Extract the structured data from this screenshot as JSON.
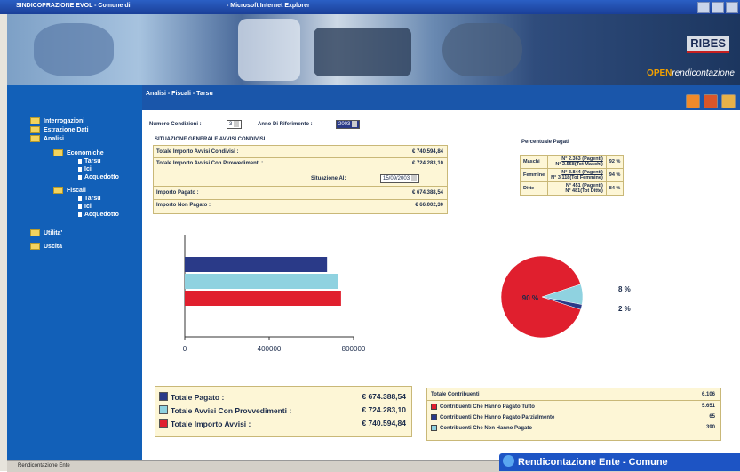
{
  "window": {
    "title": "SINDICOPRAZIONE EVOL - Comune di",
    "browser": "- Microsoft Internet Explorer"
  },
  "banner": {
    "brand": "RIBES",
    "product_a": "OPEN",
    "product_b": "rendicontazione"
  },
  "navbar": {
    "breadcrumb": "Analisi - Fiscali - Tarsu"
  },
  "sidebar": {
    "items": [
      {
        "label": "Interrogazioni"
      },
      {
        "label": "Estrazione Dati"
      },
      {
        "label": "Analisi"
      },
      {
        "label": "Economiche"
      },
      {
        "label": "Tarsu"
      },
      {
        "label": "Ici"
      },
      {
        "label": "Acquedotto"
      },
      {
        "label": "Fiscali"
      },
      {
        "label": "Tarsu"
      },
      {
        "label": "Ici"
      },
      {
        "label": "Acquedotto"
      },
      {
        "label": "Utilita'"
      },
      {
        "label": "Uscita"
      }
    ]
  },
  "filters": {
    "num_label": "Numero Condizioni :",
    "num_value": "3",
    "anno_label": "Anno Di Riferimento :",
    "anno_value": "2003"
  },
  "summary": {
    "heading": "SITUAZIONE GENERALE AVVISI CONDIVISI",
    "rows": [
      {
        "label": "Totale Importo Avvisi Condivisi :",
        "value": "€ 740.594,84"
      },
      {
        "label": "Totale Importo Avvisi Con Provvedimenti :",
        "value": "€ 724.283,10"
      },
      {
        "label": "Importo Pagato :",
        "value": "€ 674.388,54"
      },
      {
        "label": "Importo Non Pagato :",
        "value": "€ 66.002,30"
      }
    ],
    "situation_label": "Situazione Al:",
    "situation_date": "15/09/2003"
  },
  "percent_table": {
    "heading": "Percentuale Pagati",
    "rows": [
      {
        "group": "Maschi",
        "line1": "N° 2.363 (Pagenti)",
        "line2": "N° 2.558(Tot Maschi)",
        "pct": "92 %"
      },
      {
        "group": "Femmine",
        "line1": "N° 3.844 (Pagenti)",
        "line2": "N° 3.118(Tot Femmine)",
        "pct": "94 %"
      },
      {
        "group": "Ditte",
        "line1": "N° 451 (Pagenti)",
        "line2": "N° 481(Tot Ditte)",
        "pct": "84 %"
      }
    ]
  },
  "chart_data": [
    {
      "type": "bar",
      "orientation": "horizontal",
      "categories": [
        "Totale Pagato",
        "Totale Avvisi Con Provvedimenti",
        "Totale Importo Avvisi"
      ],
      "values": [
        674388.54,
        724283.1,
        740594.84
      ],
      "colors": [
        "#2a3a88",
        "#8fd2e0",
        "#e01f2e"
      ],
      "xlim": [
        0,
        800000
      ],
      "xticks": [
        "0",
        "400000",
        "800000"
      ]
    },
    {
      "type": "pie",
      "labels": [
        "Contribuenti Che Hanno Pagato Tutto",
        "Contribuenti Che Non Hanno Pagato",
        "Contribuenti Che Hanno Pagato Parzialmente"
      ],
      "values": [
        90,
        8,
        2
      ],
      "data_labels": [
        "90 %",
        "8 %",
        "2 %"
      ],
      "colors": [
        "#e01f2e",
        "#8fd2e0",
        "#2a3a88"
      ]
    }
  ],
  "legend": {
    "items": [
      {
        "label": "Totale Pagato :",
        "value": "€ 674.388,54",
        "color": "#2a3a88"
      },
      {
        "label": "Totale Avvisi Con Provvedimenti :",
        "value": "€ 724.283,10",
        "color": "#8fd2e0"
      },
      {
        "label": "Totale Importo Avvisi :",
        "value": "€ 740.594,84",
        "color": "#e01f2e"
      }
    ]
  },
  "contrib": {
    "heading": "Totale Contribuenti",
    "heading_value": "6.106",
    "rows": [
      {
        "label": "Contribuenti Che Hanno Pagato Tutto",
        "value": "5.651",
        "color": "#e01f2e"
      },
      {
        "label": "Contribuenti Che Hanno Pagato Parzialmente",
        "value": "65",
        "color": "#2a3a88"
      },
      {
        "label": "Contribuenti Che Non Hanno Pagato",
        "value": "390",
        "color": "#8fd2e0"
      }
    ]
  },
  "statusbar": {
    "text": "Rendicontazione Ente"
  },
  "taskbar": {
    "label": "Rendicontazione Ente - Comune"
  }
}
